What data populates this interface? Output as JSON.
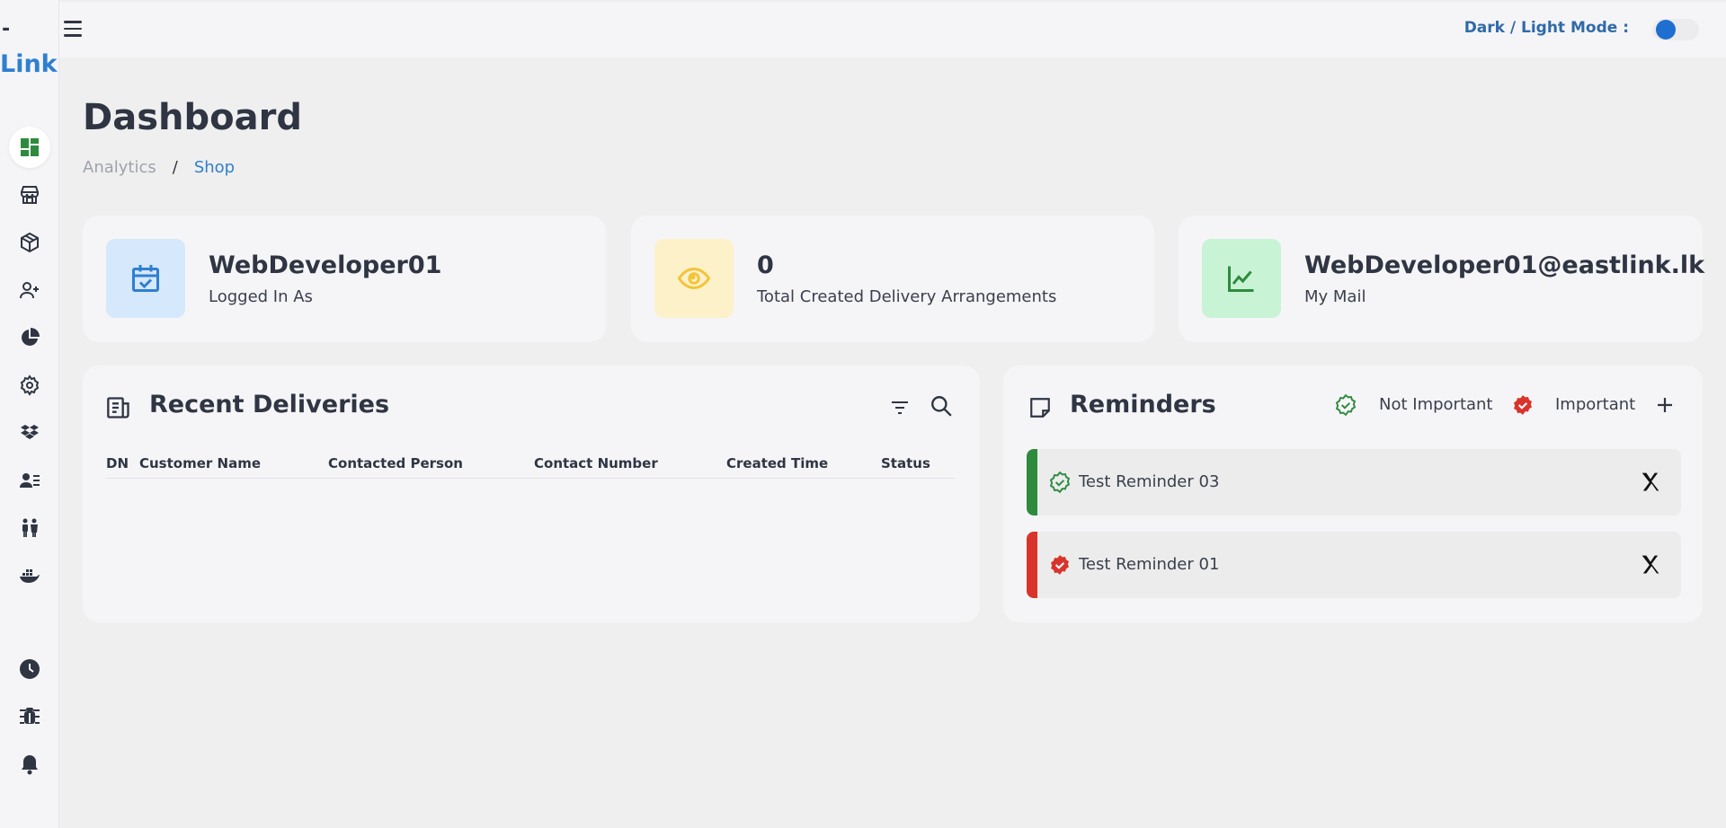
{
  "brand": {
    "prefix": "-",
    "name": "Link"
  },
  "topbar": {
    "mode_label": "Dark / Light Mode :"
  },
  "page": {
    "title": "Dashboard",
    "breadcrumb": {
      "parent": "Analytics",
      "separator": "/",
      "current": "Shop"
    }
  },
  "stats": [
    {
      "value": "WebDeveloper01",
      "label": "Logged In As",
      "icon": "calendar-check-icon",
      "bg": "#d6e8fb",
      "color": "#2f7fd1"
    },
    {
      "value": "0",
      "label": "Total Created Delivery Arrangements",
      "icon": "eye-icon",
      "bg": "#fdf1c9",
      "color": "#f2c43a"
    },
    {
      "value": "WebDeveloper01@eastlink.lk",
      "label": "My Mail",
      "icon": "trend-chart-icon",
      "bg": "#c9f3d5",
      "color": "#2e8b3e"
    }
  ],
  "deliveries": {
    "title": "Recent Deliveries",
    "columns": [
      "DN",
      "Customer Name",
      "Contacted Person",
      "Contact Number",
      "Created Time",
      "Status"
    ],
    "rows": []
  },
  "reminders": {
    "title": "Reminders",
    "legend": {
      "not_important": "Not Important",
      "important": "Important"
    },
    "items": [
      {
        "text": "Test Reminder 03",
        "type": "not-important"
      },
      {
        "text": "Test Reminder 01",
        "type": "important"
      }
    ]
  },
  "colors": {
    "accent": "#2f7fd1",
    "green": "#2e8b3e",
    "red": "#d9342b",
    "toggle": "#1f6fd1"
  }
}
